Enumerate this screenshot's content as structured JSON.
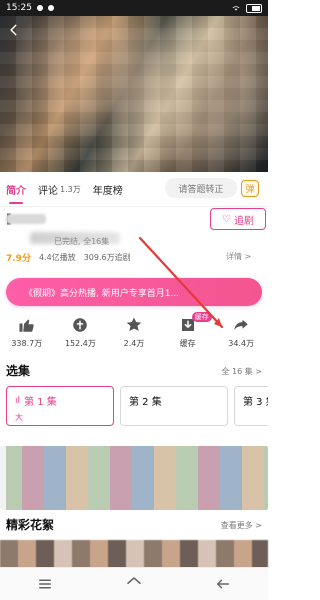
{
  "status_bar": {
    "time": "15:25",
    "battery": ""
  },
  "tabs": [
    {
      "label": "简介",
      "count": ""
    },
    {
      "label": "评论",
      "count": "1.3万"
    },
    {
      "label": "年度榜",
      "count": ""
    }
  ],
  "top_actions": {
    "danmu_placeholder": "请答题转正",
    "danmu_toggle_label": "弹"
  },
  "show": {
    "title": "[",
    "meta": "已完结, 全16集",
    "rating": "7.9分",
    "plays": "4.4亿播放",
    "follows": "309.6万追剧",
    "detail_link": "详情 >",
    "follow_button": "追剧"
  },
  "banner": {
    "text": "《假期》高分热播, 新用户专享首月1..."
  },
  "actions": [
    {
      "name": "like",
      "value": "338.7万"
    },
    {
      "name": "coin",
      "value": "152.4万"
    },
    {
      "name": "star",
      "value": "2.4万"
    },
    {
      "name": "cache",
      "value": "缓存"
    },
    {
      "name": "share",
      "value": "34.4万"
    }
  ],
  "episodes_section": {
    "title": "选集",
    "more": "全 16 集 >"
  },
  "episodes": [
    {
      "label": "第 1 集",
      "sub": "大"
    },
    {
      "label": "第 2 集",
      "sub": ""
    },
    {
      "label": "第 3 集",
      "sub": ""
    }
  ],
  "highlights_section": {
    "title": "精彩花絮",
    "more": "查看更多 >"
  },
  "cache_badge": "缓存",
  "colors": {
    "accent": "#e83e8c",
    "rating": "#f29b1d",
    "arrow": "#e53935"
  }
}
